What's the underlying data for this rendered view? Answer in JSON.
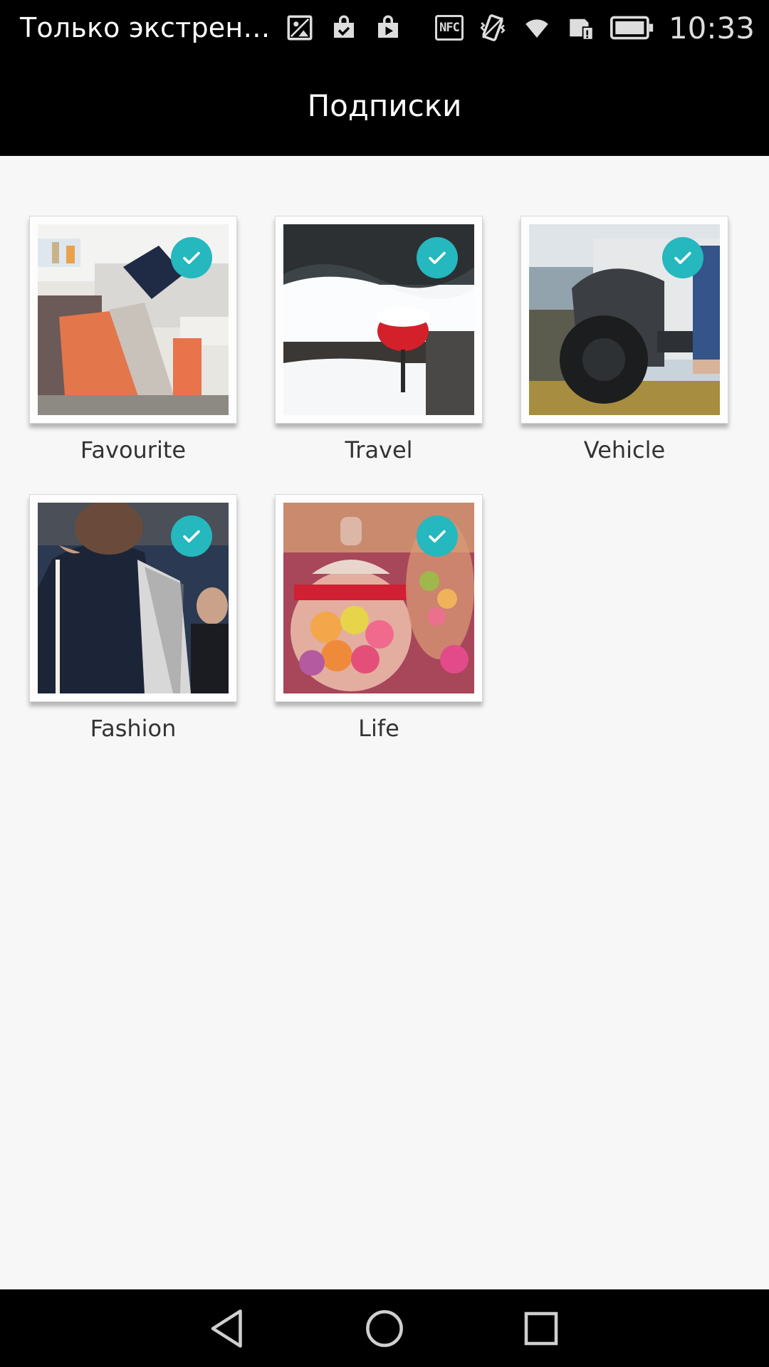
{
  "status_bar": {
    "carrier_text": "Только экстрен…",
    "time": "10:33",
    "nfc_label": "NFC",
    "left_icons": [
      "image-icon",
      "shopping-bag-check-icon",
      "play-store-icon"
    ],
    "right_icons": [
      "nfc-icon",
      "vibrate-icon",
      "wifi-icon",
      "sim-icon",
      "battery-icon"
    ]
  },
  "header": {
    "title": "Подписки"
  },
  "subscriptions": [
    {
      "label": "Favourite",
      "checked": true,
      "theme": "living-room"
    },
    {
      "label": "Travel",
      "checked": true,
      "theme": "snow-village"
    },
    {
      "label": "Vehicle",
      "checked": true,
      "theme": "jeep-wheel"
    },
    {
      "label": "Fashion",
      "checked": true,
      "theme": "tailor-suit"
    },
    {
      "label": "Life",
      "checked": true,
      "theme": "candy-jars"
    }
  ],
  "colors": {
    "accent": "#25b8be",
    "background": "#f7f7f7",
    "bars": "#000000"
  },
  "nav_bar": {
    "buttons": [
      "back-icon",
      "home-icon",
      "recents-icon"
    ]
  }
}
